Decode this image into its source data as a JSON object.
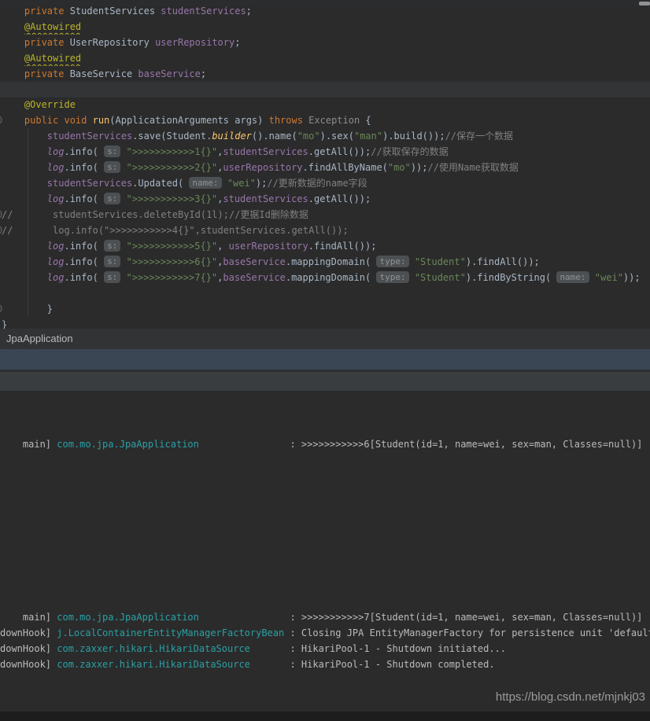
{
  "editor": {
    "fields_block": {
      "lines": [
        {
          "segments": [
            {
              "t": "    ",
              "c": "d"
            },
            {
              "t": "private ",
              "c": "k"
            },
            {
              "t": "StudentServices ",
              "c": "d"
            },
            {
              "t": "studentServices",
              "c": "f"
            },
            {
              "t": ";",
              "c": "d"
            }
          ]
        },
        {
          "segments": [
            {
              "t": "    ",
              "c": "d"
            },
            {
              "t": "@Autowired",
              "c": "aw"
            }
          ]
        },
        {
          "segments": [
            {
              "t": "    ",
              "c": "d"
            },
            {
              "t": "private ",
              "c": "k"
            },
            {
              "t": "UserRepository ",
              "c": "d"
            },
            {
              "t": "userRepository",
              "c": "f"
            },
            {
              "t": ";",
              "c": "d"
            }
          ]
        },
        {
          "segments": [
            {
              "t": "    ",
              "c": "d"
            },
            {
              "t": "@Autowired",
              "c": "aw"
            }
          ]
        },
        {
          "segments": [
            {
              "t": "    ",
              "c": "d"
            },
            {
              "t": "private ",
              "c": "k"
            },
            {
              "t": "BaseService ",
              "c": "d"
            },
            {
              "t": "baseService",
              "c": "f"
            },
            {
              "t": ";",
              "c": "d"
            }
          ]
        }
      ]
    },
    "run_block": {
      "lines": [
        {
          "segments": [
            {
              "t": "    ",
              "c": "d"
            },
            {
              "t": "@Override",
              "c": "a"
            }
          ]
        },
        {
          "gutter": "0",
          "segments": [
            {
              "t": "    ",
              "c": "d"
            },
            {
              "t": "public void ",
              "c": "k"
            },
            {
              "t": "run",
              "c": "md"
            },
            {
              "t": "(ApplicationArguments args) ",
              "c": "d"
            },
            {
              "t": "throws ",
              "c": "k"
            },
            {
              "t": "Exception ",
              "c": "dim"
            },
            {
              "t": "{",
              "c": "d"
            }
          ]
        },
        {
          "segments": [
            {
              "t": "        ",
              "c": "d"
            },
            {
              "t": "studentServices",
              "c": "f"
            },
            {
              "t": ".save(Student.",
              "c": "d"
            },
            {
              "t": "builder",
              "c": "sm"
            },
            {
              "t": "().name(",
              "c": "d"
            },
            {
              "t": "\"mo\"",
              "c": "s"
            },
            {
              "t": ").sex(",
              "c": "d"
            },
            {
              "t": "\"man\"",
              "c": "s"
            },
            {
              "t": ").build());",
              "c": "d"
            },
            {
              "t": "//保存一个数据",
              "c": "c"
            }
          ]
        },
        {
          "segments": [
            {
              "t": "        ",
              "c": "d"
            },
            {
              "t": "log",
              "c": "lv"
            },
            {
              "t": ".info( ",
              "c": "d"
            },
            {
              "t": "s:",
              "c": "h"
            },
            {
              "t": " ",
              "c": "d"
            },
            {
              "t": "\">>>>>>>>>>>1{}\"",
              "c": "s"
            },
            {
              "t": ",",
              "c": "d"
            },
            {
              "t": "studentServices",
              "c": "f"
            },
            {
              "t": ".getAll());",
              "c": "d"
            },
            {
              "t": "//获取保存的数据",
              "c": "c"
            }
          ]
        },
        {
          "segments": [
            {
              "t": "        ",
              "c": "d"
            },
            {
              "t": "log",
              "c": "lv"
            },
            {
              "t": ".info( ",
              "c": "d"
            },
            {
              "t": "s:",
              "c": "h"
            },
            {
              "t": " ",
              "c": "d"
            },
            {
              "t": "\">>>>>>>>>>>2{}\"",
              "c": "s"
            },
            {
              "t": ",",
              "c": "d"
            },
            {
              "t": "userRepository",
              "c": "f"
            },
            {
              "t": ".findAllByName(",
              "c": "d"
            },
            {
              "t": "\"mo\"",
              "c": "s"
            },
            {
              "t": "));",
              "c": "d"
            },
            {
              "t": "//使用Name获取数据",
              "c": "c"
            }
          ]
        },
        {
          "segments": [
            {
              "t": "        ",
              "c": "d"
            },
            {
              "t": "studentServices",
              "c": "f"
            },
            {
              "t": ".Updated( ",
              "c": "d"
            },
            {
              "t": "name:",
              "c": "h"
            },
            {
              "t": " ",
              "c": "d"
            },
            {
              "t": "\"wei\"",
              "c": "s"
            },
            {
              "t": ");",
              "c": "d"
            },
            {
              "t": "//更新数据的name字段",
              "c": "c"
            }
          ]
        },
        {
          "segments": [
            {
              "t": "        ",
              "c": "d"
            },
            {
              "t": "log",
              "c": "lv"
            },
            {
              "t": ".info( ",
              "c": "d"
            },
            {
              "t": "s:",
              "c": "h"
            },
            {
              "t": " ",
              "c": "d"
            },
            {
              "t": "\">>>>>>>>>>>3{}\"",
              "c": "s"
            },
            {
              "t": ",",
              "c": "d"
            },
            {
              "t": "studentServices",
              "c": "f"
            },
            {
              "t": ".getAll());",
              "c": "d"
            }
          ]
        },
        {
          "gutter": "0",
          "segments": [
            {
              "t": "//       studentServices.deleteById(1l);//更据Id删除数据",
              "c": "c"
            }
          ]
        },
        {
          "gutter": "0",
          "segments": [
            {
              "t": "//       log.info(\">>>>>>>>>>>4{}\",studentServices.getAll());",
              "c": "c"
            }
          ]
        },
        {
          "segments": [
            {
              "t": "        ",
              "c": "d"
            },
            {
              "t": "log",
              "c": "lv"
            },
            {
              "t": ".info( ",
              "c": "d"
            },
            {
              "t": "s:",
              "c": "h"
            },
            {
              "t": " ",
              "c": "d"
            },
            {
              "t": "\">>>>>>>>>>>5{}\"",
              "c": "s"
            },
            {
              "t": ", ",
              "c": "d"
            },
            {
              "t": "userRepository",
              "c": "f"
            },
            {
              "t": ".findAll());",
              "c": "d"
            }
          ]
        },
        {
          "segments": [
            {
              "t": "        ",
              "c": "d"
            },
            {
              "t": "log",
              "c": "lv"
            },
            {
              "t": ".info( ",
              "c": "d"
            },
            {
              "t": "s:",
              "c": "h"
            },
            {
              "t": " ",
              "c": "d"
            },
            {
              "t": "\">>>>>>>>>>>6{}\"",
              "c": "s"
            },
            {
              "t": ",",
              "c": "d"
            },
            {
              "t": "baseService",
              "c": "f"
            },
            {
              "t": ".mappingDomain( ",
              "c": "d"
            },
            {
              "t": "type:",
              "c": "h"
            },
            {
              "t": " ",
              "c": "d"
            },
            {
              "t": "\"Student\"",
              "c": "s"
            },
            {
              "t": ").findAll());",
              "c": "d"
            }
          ]
        },
        {
          "segments": [
            {
              "t": "        ",
              "c": "d"
            },
            {
              "t": "log",
              "c": "lv"
            },
            {
              "t": ".info( ",
              "c": "d"
            },
            {
              "t": "s:",
              "c": "h"
            },
            {
              "t": " ",
              "c": "d"
            },
            {
              "t": "\">>>>>>>>>>>7{}\"",
              "c": "s"
            },
            {
              "t": ",",
              "c": "d"
            },
            {
              "t": "baseService",
              "c": "f"
            },
            {
              "t": ".mappingDomain( ",
              "c": "d"
            },
            {
              "t": "type:",
              "c": "h"
            },
            {
              "t": " ",
              "c": "d"
            },
            {
              "t": "\"Student\"",
              "c": "s"
            },
            {
              "t": ").findByString( ",
              "c": "d"
            },
            {
              "t": "name:",
              "c": "h"
            },
            {
              "t": " ",
              "c": "d"
            },
            {
              "t": "\"wei\"",
              "c": "s"
            },
            {
              "t": "));",
              "c": "d"
            }
          ]
        },
        {
          "segments": []
        },
        {
          "gutter": "0",
          "segments": [
            {
              "t": "        }",
              "c": "d"
            }
          ]
        },
        {
          "segments": [
            {
              "t": "}",
              "c": "d"
            }
          ]
        }
      ]
    }
  },
  "run_panel": {
    "tab_label": "JpaApplication",
    "console_upper": [
      {
        "pre": "    main] ",
        "logger": "com.mo.jpa.JpaApplication",
        "post": "                : >>>>>>>>>>>6[Student(id=1, name=wei, sex=man, Classes=null)]"
      }
    ],
    "console_lower": [
      {
        "pre": "    main] ",
        "logger": "com.mo.jpa.JpaApplication",
        "post": "                : >>>>>>>>>>>7[Student(id=1, name=wei, sex=man, Classes=null)]"
      },
      {
        "pre": "downHook] ",
        "logger": "j.LocalContainerEntityManagerFactoryBean",
        "post": " : Closing JPA EntityManagerFactory for persistence unit 'default'"
      },
      {
        "pre": "downHook] ",
        "logger": "com.zaxxer.hikari.HikariDataSource",
        "post": "       : HikariPool-1 - Shutdown initiated..."
      },
      {
        "pre": "downHook] ",
        "logger": "com.zaxxer.hikari.HikariDataSource",
        "post": "       : HikariPool-1 - Shutdown completed."
      }
    ]
  },
  "watermark": "https://blog.csdn.net/mjnkj03",
  "colors": {
    "editor_bg": "#2B2B2B",
    "keyword": "#CC7832",
    "field": "#9876AA",
    "string": "#6A8759",
    "comment": "#808080",
    "annotation": "#BBB529",
    "method": "#FFC66B",
    "logger_teal": "#2AA0A5",
    "selected_row_blue": "#3A4654"
  }
}
